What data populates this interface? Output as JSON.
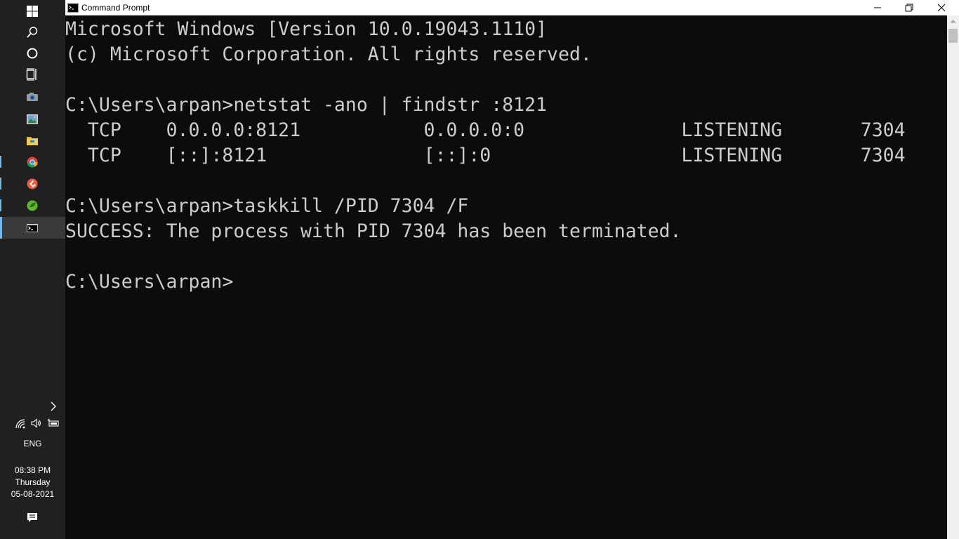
{
  "window": {
    "title": "Command Prompt"
  },
  "console": {
    "lines": [
      "Microsoft Windows [Version 10.0.19043.1110]",
      "(c) Microsoft Corporation. All rights reserved.",
      "",
      "C:\\Users\\arpan>netstat -ano | findstr :8121",
      "  TCP    0.0.0.0:8121           0.0.0.0:0              LISTENING       7304",
      "  TCP    [::]:8121              [::]:0                 LISTENING       7304",
      "",
      "C:\\Users\\arpan>taskkill /PID 7304 /F",
      "SUCCESS: The process with PID 7304 has been terminated.",
      "",
      "C:\\Users\\arpan>"
    ]
  },
  "taskbar": {
    "apps": [
      {
        "icon": "windows-start-icon"
      },
      {
        "icon": "search-icon"
      },
      {
        "icon": "cortana-icon"
      },
      {
        "icon": "task-view-icon"
      },
      {
        "icon": "camera-icon"
      },
      {
        "icon": "photos-icon"
      },
      {
        "icon": "file-explorer-icon"
      },
      {
        "icon": "chrome-icon"
      },
      {
        "icon": "app-red-icon"
      },
      {
        "icon": "app-green-icon"
      },
      {
        "icon": "command-prompt-icon"
      }
    ],
    "tray": {
      "language": "ENG",
      "time": "08:38 PM",
      "day": "Thursday",
      "date": "05-08-2021"
    }
  },
  "colors": {
    "console_bg": "#0c0c0c",
    "console_fg": "#cccccc",
    "taskbar_bg": "#202020",
    "accent": "#76b9ed"
  }
}
